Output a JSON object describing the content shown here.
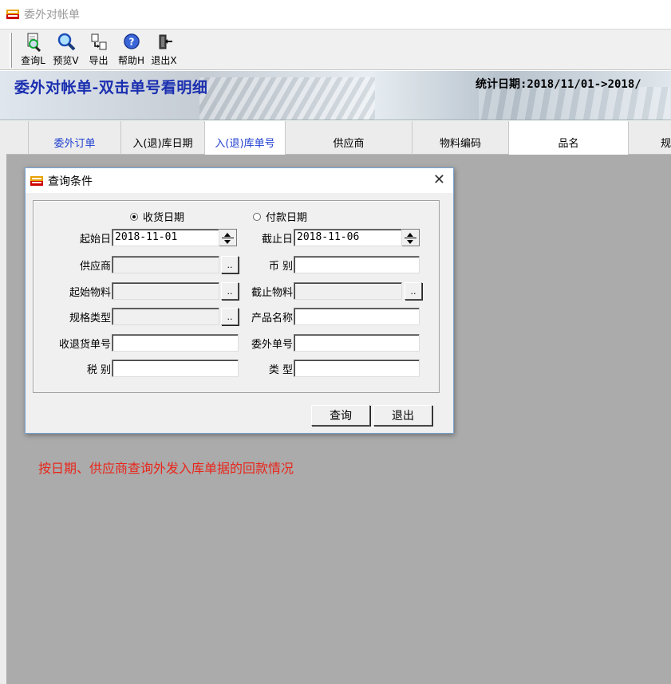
{
  "window": {
    "title": "委外对帐单"
  },
  "toolbar": {
    "buttons": [
      {
        "label": "查询L",
        "icon": "document-magnifier-icon"
      },
      {
        "label": "预览V",
        "icon": "magnifier-icon"
      },
      {
        "label": "导出",
        "icon": "export-icon"
      },
      {
        "label": "帮助H",
        "icon": "help-icon"
      },
      {
        "label": "退出X",
        "icon": "exit-door-icon"
      }
    ]
  },
  "banner": {
    "heading": "委外对帐单-双击单号看明细",
    "stat": "统计日期:2018/11/01->2018/"
  },
  "grid": {
    "columns": [
      "委外订单",
      "入(退)库日期",
      "入(退)库单号",
      "供应商",
      "物料编码",
      "品名",
      "规"
    ]
  },
  "hint": "按日期、供应商查询外发入库单据的回款情况",
  "dialog": {
    "title": "查询条件",
    "radio_receive": "收货日期",
    "radio_pay": "付款日期",
    "selected_radio": "收货日期",
    "labels": {
      "start_date": "起始日",
      "end_date": "截止日",
      "supplier": "供应商",
      "currency": "币  别",
      "start_material": "起始物料",
      "end_material": "截止物料",
      "spec_type": "规格类型",
      "product_name": "产品名称",
      "receipt_no": "收退货单号",
      "outsource_no": "委外单号",
      "tax_type": "税  别",
      "category": "类  型"
    },
    "values": {
      "start_date": "2018-11-01",
      "end_date": "2018-11-06",
      "supplier": "",
      "currency": "",
      "start_material": "",
      "end_material": "",
      "spec_type": "",
      "product_name": "",
      "receipt_no": "",
      "outsource_no": "",
      "tax_type": "",
      "category": ""
    },
    "browse_label": "..",
    "query_button": "查询",
    "exit_button": "退出",
    "close_glyph": "✕"
  }
}
